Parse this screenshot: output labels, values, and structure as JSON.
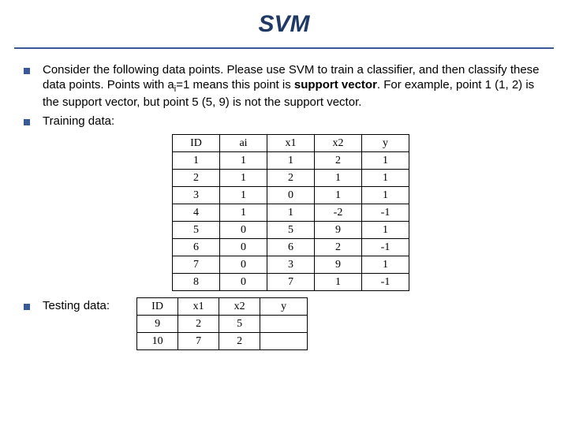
{
  "title": "SVM",
  "bullets": {
    "p1_pre": "Consider the following data points. Please use SVM to train a classifier, and then classify these data points. Points with a",
    "p1_sub": "i",
    "p1_mid": "=1 means this point is ",
    "p1_bold1": "support vector",
    "p1_after": ". For example, point 1 (1, 2) is the support vector, but point 5 (5, 9) is not the support vector.",
    "p2": "Training data:",
    "p3": "Testing data:"
  },
  "train": {
    "headers": [
      "ID",
      "ai",
      "x1",
      "x2",
      "y"
    ],
    "rows": [
      [
        "1",
        "1",
        "1",
        "2",
        "1"
      ],
      [
        "2",
        "1",
        "2",
        "1",
        "1"
      ],
      [
        "3",
        "1",
        "0",
        "1",
        "1"
      ],
      [
        "4",
        "1",
        "1",
        "-2",
        "-1"
      ],
      [
        "5",
        "0",
        "5",
        "9",
        "1"
      ],
      [
        "6",
        "0",
        "6",
        "2",
        "-1"
      ],
      [
        "7",
        "0",
        "3",
        "9",
        "1"
      ],
      [
        "8",
        "0",
        "7",
        "1",
        "-1"
      ]
    ]
  },
  "test": {
    "headers": [
      "ID",
      "x1",
      "x2",
      "y"
    ],
    "rows": [
      [
        "9",
        "2",
        "5",
        ""
      ],
      [
        "10",
        "7",
        "2",
        ""
      ]
    ]
  }
}
